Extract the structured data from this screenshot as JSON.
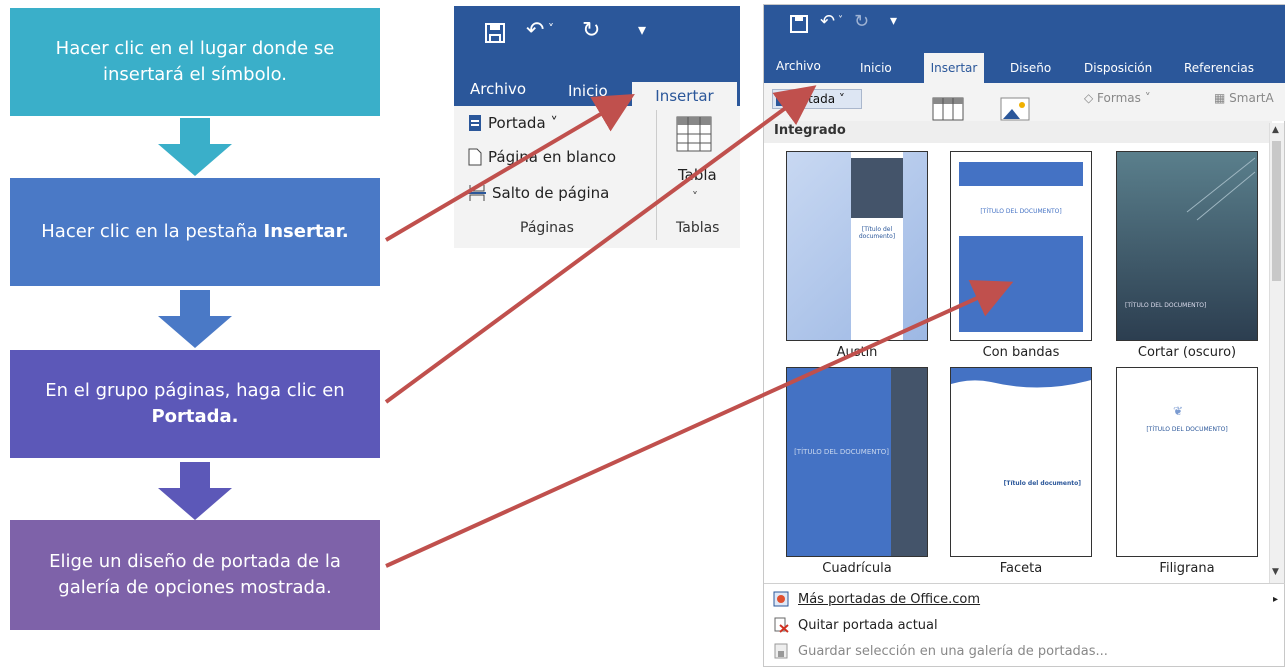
{
  "steps": [
    {
      "text": "Hacer clic en el lugar donde se insertará el símbolo.",
      "color": "#3aafc9"
    },
    {
      "pre": "Hacer clic en la pestaña ",
      "bold": "Insertar.",
      "color": "#4a79c6"
    },
    {
      "pre": "En el grupo páginas, haga clic en ",
      "bold": "Portada.",
      "color": "#5c58b8"
    },
    {
      "text": "Elige un diseño de portada de la galería de opciones mostrada.",
      "color": "#7e62a9"
    }
  ],
  "ribbon_small": {
    "tabs": [
      "Archivo",
      "Inicio",
      "Insertar"
    ],
    "items": [
      "Portada ˅",
      "Página en blanco",
      "Salto de página"
    ],
    "group_pages": "Páginas",
    "tabla": "Tabla",
    "group_tables": "Tablas"
  },
  "ribbon_large": {
    "tabs": [
      "Archivo",
      "Inicio",
      "Insertar",
      "Diseño",
      "Disposición",
      "Referencias"
    ],
    "portada_btn": "Portada ˅",
    "formas": "Formas ˅",
    "smartart": "SmartA",
    "gallery_header": "Integrado",
    "thumbs": [
      "Austin",
      "Con bandas",
      "Cortar (oscuro)",
      "Cuadrícula",
      "Faceta",
      "Filigrana"
    ],
    "thumb_texts": {
      "austin": "[Título del documento]",
      "bandas": "[TÍTULO DEL DOCUMENTO]",
      "oscuro": "[TÍTULO DEL DOCUMENTO]",
      "cuadricula": "[TÍTULO DEL DOCUMENTO]",
      "faceta": "[Título del documento]",
      "filigrana": "[TÍTULO DEL DOCUMENTO]"
    },
    "menu": [
      "Más portadas de Office.com",
      "Quitar portada actual",
      "Guardar selección en una galería de portadas..."
    ]
  },
  "colors": {
    "word_blue": "#2b579a",
    "arrow_red": "#c0504d"
  }
}
